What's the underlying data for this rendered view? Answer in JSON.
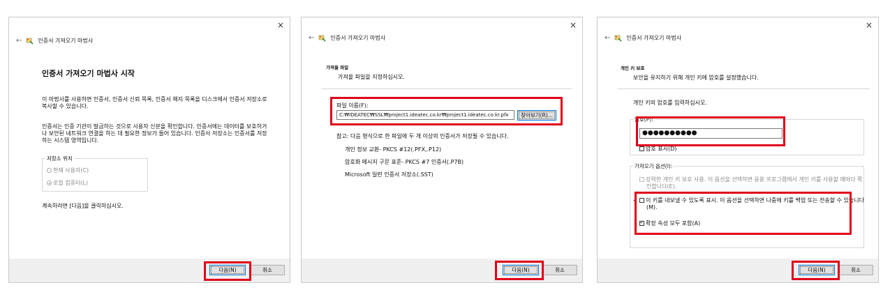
{
  "common": {
    "wizard_title": "인증서 가져오기 마법사",
    "close": "×",
    "back": "←",
    "next_label": "다음(N)",
    "cancel_label": "취소"
  },
  "panel1": {
    "heading": "인증서 가져오기 마법사 시작",
    "para1": "이 마법사를 사용하면 인증서, 인증서 신뢰 목록, 인증서 해지 목록을 디스크에서 인증서 저장소로 복사할 수 있습니다.",
    "para2": "인증서는 인증 기관이 발급하는 것으로 사용자 신분을 확인합니다. 인증서에는 데이터를 보호하거나 보안된 네트워크 연결을 하는 데 필요한 정보가 들어 있습니다. 인증서 저장소는 인증서를 저장하는 시스템 영역입니다.",
    "store_location_label": "저장소 위치",
    "radio_current_user": "현재 사용자(C)",
    "radio_local_machine": "로컬 컴퓨터(L)",
    "continue_text": "계속하려면 [다음]을 클릭하십시오."
  },
  "panel2": {
    "section_title": "가져올 파일",
    "section_subtitle": "가져올 파일을 지정하십시오.",
    "file_name_label": "파일 이름(F):",
    "file_path": "C:₩IDEATEC₩SSL₩project1.ideatec.co.kr₩project1.ideatec.co.kr.pfx",
    "browse_label": "찾아보기(R)...",
    "note": "참고: 다음 형식으로 한 파일에 두 개 이상의 인증서가 저장될 수 있습니다.",
    "formats": [
      "개인 정보 교환- PKCS #12(.PFX,.P12)",
      "암호화 메시지 구문 표준- PKCS #7 인증서(.P7B)",
      "Microsoft 일련 인증서 저장소(.SST)"
    ]
  },
  "panel3": {
    "section_title": "개인 키 보호",
    "section_subtitle": "보안을 유지하기 위해 개인 키에 암호를 설정했습니다.",
    "instruction": "개인 키의 암호를 입력하십시오.",
    "password_label": "암호(P):",
    "password_value": "●●●●●●●●●●",
    "show_password_label": "암호 표시(D)",
    "import_options_label": "가져오기 옵션(I):",
    "option_strong": "강력한 개인 키 보호 사용. 이 옵션을 선택하면 응용 프로그램에서 개인 키를 사용할 때마다 확인합니다(E).",
    "option_exportable": "이 키를 내보낼 수 있도록 표시. 이 옵션을 선택하면 나중에 키를 백업 또는 전송할 수 있습니다(M).",
    "option_extended": "확장 속성 모두 포함(A)"
  },
  "colors": {
    "highlight": "#e0001a",
    "footer": "#f0f0f0",
    "border": "#c9c9c9"
  }
}
